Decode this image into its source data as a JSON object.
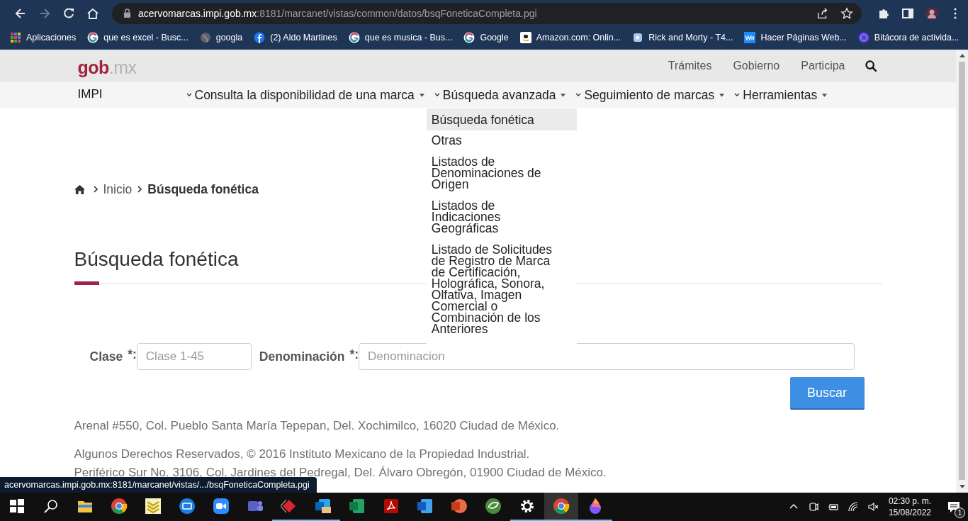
{
  "browser": {
    "forward_disabled": true,
    "url_host": "acervomarcas.impi.gob.mx",
    "url_path": ":8181/marcanet/vistas/common/datos/bsqFoneticaCompleta.pgi",
    "bookmarks": [
      {
        "kind": "apps",
        "label": "Aplicaciones"
      },
      {
        "kind": "google",
        "label": "que es excel - Busc..."
      },
      {
        "kind": "globe",
        "label": "googla"
      },
      {
        "kind": "facebook",
        "label": "(2) Aldo Martines"
      },
      {
        "kind": "google",
        "label": "que es musica - Bus..."
      },
      {
        "kind": "google",
        "label": "Google"
      },
      {
        "kind": "amazon",
        "label": "Amazon.com: Onlin..."
      },
      {
        "kind": "page",
        "label": "Rick and Morty - T4..."
      },
      {
        "kind": "wn",
        "label": "Hacer Páginas Web..."
      },
      {
        "kind": "canva",
        "label": "Bitácora de activida..."
      }
    ]
  },
  "site": {
    "logo_main": "gob",
    "logo_suffix": ".mx",
    "top_links": [
      "Trámites",
      "Gobierno",
      "Participa"
    ],
    "name": "IMPI",
    "menu": [
      {
        "label": "Consulta la disponibilidad de una marca"
      },
      {
        "label": "Búsqueda avanzada",
        "items": [
          {
            "label": "Búsqueda fonética",
            "selected": true
          },
          {
            "label": "Otras",
            "selected": false
          },
          {
            "label": "Listados de Denominaciones de Origen",
            "selected": false
          },
          {
            "label": "Listados de Indicaciones Geográficas",
            "selected": false
          },
          {
            "label": "Listado de Solicitudes de Registro de Marca de Certificación, Holográfica, Sonora, Olfativa, Imagen Comercial o Combinación de los Anteriores",
            "selected": false
          }
        ]
      },
      {
        "label": "Seguimiento de marcas"
      },
      {
        "label": "Herramientas"
      }
    ]
  },
  "breadcrumb": [
    "Inicio",
    "Búsqueda fonética"
  ],
  "page_title": "Búsqueda fonética",
  "form": {
    "fields": [
      {
        "label": "Clase",
        "required": "*:",
        "placeholder": "Clase 1-45"
      },
      {
        "label": "Denominación",
        "required": "*:",
        "placeholder": "Denominacion"
      }
    ],
    "button": "Buscar"
  },
  "footer": [
    "Arenal #550, Col. Pueblo Santa María Tepepan, Del. Xochimilco, 16020 Ciudad de México.",
    "Algunos Derechos Reservados, © 2016 Instituto Mexicano de la Propiedad Industrial.",
    "Periférico Sur No. 3106, Col. Jardines del Pedregal, Del. Álvaro Obregón, 01900 Ciudad de México."
  ],
  "status_url": "acervomarcas.impi.gob.mx:8181/marcanet/vistas/.../bsqFoneticaCompleta.pgi",
  "taskbar": {
    "apps": [
      {
        "kind": "start",
        "open": false,
        "selected": false
      },
      {
        "kind": "search",
        "open": false,
        "selected": false
      },
      {
        "kind": "folder",
        "open": false,
        "selected": false
      },
      {
        "kind": "browser",
        "open": false,
        "selected": false
      },
      {
        "kind": "chevron",
        "open": false,
        "selected": false
      },
      {
        "kind": "camera",
        "open": false,
        "selected": false
      },
      {
        "kind": "video",
        "open": false,
        "selected": false
      },
      {
        "kind": "chat",
        "open": false,
        "selected": false
      },
      {
        "kind": "diamond",
        "open": true,
        "selected": false
      },
      {
        "kind": "mail",
        "open": true,
        "selected": false
      },
      {
        "kind": "sheet",
        "open": false,
        "selected": false
      },
      {
        "kind": "pdf",
        "open": false,
        "selected": false
      },
      {
        "kind": "doc",
        "open": false,
        "selected": false
      },
      {
        "kind": "slides",
        "open": false,
        "selected": false
      },
      {
        "kind": "leaf",
        "open": false,
        "selected": false
      },
      {
        "kind": "gear",
        "open": true,
        "selected": false
      },
      {
        "kind": "browser",
        "open": true,
        "selected": true
      },
      {
        "kind": "drop",
        "open": true,
        "selected": false
      }
    ],
    "time": "02:30 p. m.",
    "date": "15/08/2022",
    "notifications": "1"
  }
}
